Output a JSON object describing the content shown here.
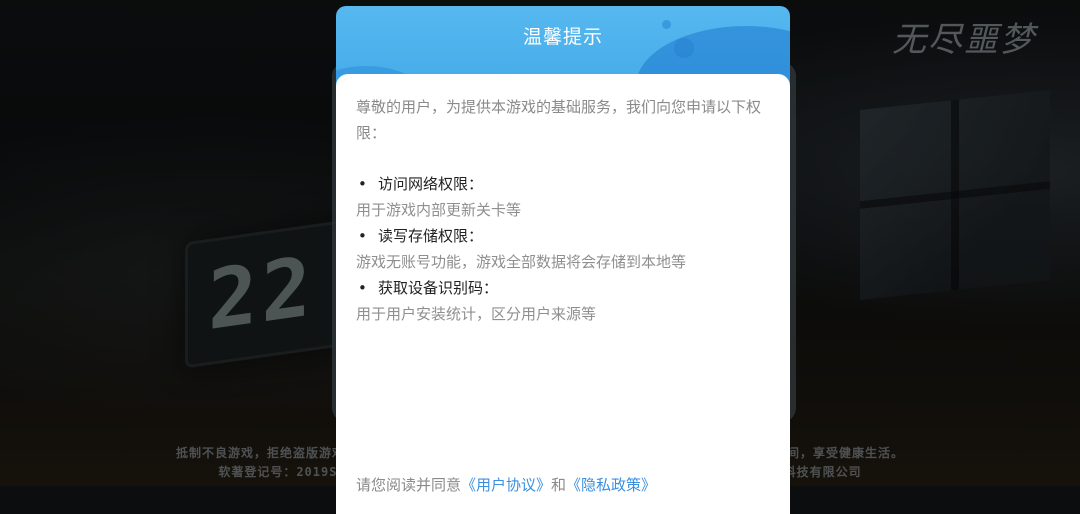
{
  "background": {
    "clock_text": "22",
    "logo_text": "无尽噩梦",
    "notice_line1": "抵制不良游戏，拒绝盗版游戏，注意自我保护，谨防受骗上当。适度游戏益脑，沉迷游戏伤身，合理安排时间，享受健康生活。",
    "notice_line2": "软著登记号：2019SR1183510  著作权人：郑州宸冠软件科技有限公司  出版单位：郑州宸冠软件科技有限公司"
  },
  "dialog": {
    "title": "温馨提示",
    "intro": "尊敬的用户，为提供本游戏的基础服务，我们向您申请以下权限：",
    "permissions": [
      {
        "bullet": "•",
        "title": "访问网络权限：",
        "desc": "用于游戏内部更新关卡等"
      },
      {
        "bullet": "•",
        "title": "读写存储权限：",
        "desc": "游戏无账号功能，游戏全部数据将会存储到本地等"
      },
      {
        "bullet": "•",
        "title": "获取设备识别码：",
        "desc": "用于用户安装统计，区分用户来源等"
      }
    ],
    "footer": {
      "prefix": "请您阅读并同意",
      "user_agreement": "《用户协议》",
      "and": "和",
      "privacy_policy": "《隐私政策》"
    }
  },
  "colors": {
    "header_blue": "#3ea5e7",
    "link_blue": "#3b8fe0"
  }
}
